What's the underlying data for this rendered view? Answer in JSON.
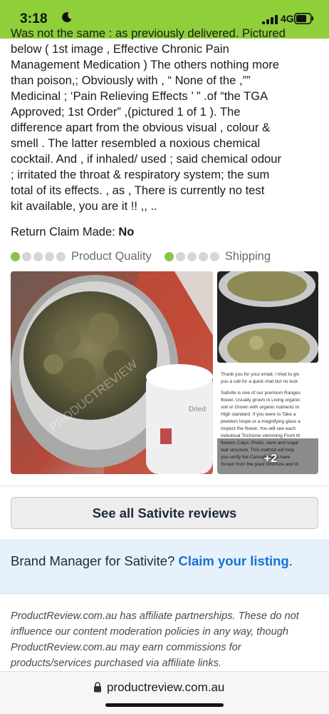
{
  "status_bar": {
    "time": "3:18",
    "network": "4G"
  },
  "review": {
    "body_lines": [
      "Was not the same : as previously delivered. Pictured",
      "below ( 1st image , Effective Chronic Pain",
      "Management Medication ) The others nothing more",
      "than poison,; Obviously with , “ None of the ,””",
      "Medicinal ; ‘Pain Relieving Effects ’ ” .of “the TGA",
      "Approved; 1st Order” ,(pictured 1 of 1 ). The",
      "difference apart from the obvious visual , colour &",
      "smell . The latter resembled a noxious chemical",
      "cocktail. And , if inhaled/ used ; said chemical odour",
      "; irritated the throat & respiratory system; the sum",
      "total of its effects. , as , There is currently no test",
      "kit available, you are it !! ,, .."
    ],
    "return_claim_label": "Return Claim Made:",
    "return_claim_value": "No",
    "ratings": [
      {
        "label": "Product Quality",
        "score": 1,
        "max": 5
      },
      {
        "label": "Shipping",
        "score": 1,
        "max": 5
      }
    ],
    "photos_more_label": "+2",
    "watermark": "PRODUCTREVIEW",
    "side_screenshot_lines": [
      "Thank you for your email, I tried to giv",
      "you a call for a quick chat but no luck",
      "Sativite is one of our premium Ranges",
      "flower, Usually grown in Living organic",
      "soil or Grown with organic nutrients to",
      "High standard. If you were to Take a",
      "jewelers loupe or a magnifying glass a",
      "inspect the flower, You will see each",
      "individual Trichome stemming From th",
      "flowers Calyx, Pistils, stem and sugar",
      "leaf structure. This method will help",
      "you verify the Cannabinoids have",
      "Grown from the plant structure and th"
    ],
    "jar_label_text": "Dried"
  },
  "actions": {
    "see_all_label": "See all Sativite reviews"
  },
  "brand": {
    "prefix": "Brand Manager for Sativite? ",
    "link": "Claim your listing",
    "suffix": "."
  },
  "disclaimer": "ProductReview.com.au has affiliate partnerships. These do not influence our content moderation policies in any way, though ProductReview.com.au may earn commissions for products/services purchased via affiliate links.",
  "url_bar": {
    "domain": "productreview.com.au"
  },
  "colors": {
    "status_bar": "#8fcf3a",
    "rating_on": "#8bc34a",
    "rating_off": "#d6d6d6",
    "link": "#1771d4",
    "brand_box_bg": "#e6f1fb"
  }
}
